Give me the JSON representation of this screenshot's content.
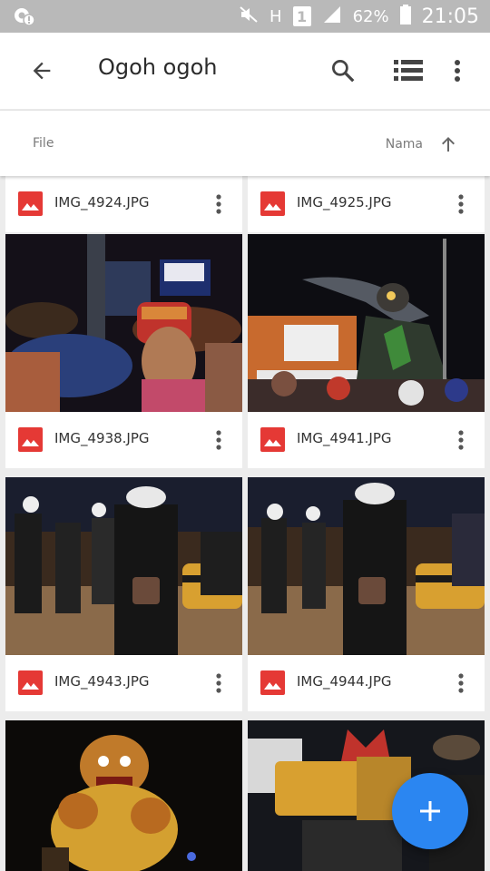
{
  "status_bar": {
    "network_label": "H",
    "sim_label": "1",
    "battery_percent": "62%",
    "time": "21:05",
    "icons": [
      "notification-alert-icon",
      "mute-icon",
      "sim-icon",
      "signal-icon",
      "battery-icon"
    ]
  },
  "app_bar": {
    "title": "Ogoh ogoh",
    "icons": [
      "back-arrow-icon",
      "search-icon",
      "list-view-icon",
      "more-vert-icon"
    ]
  },
  "sort_bar": {
    "left_label": "File",
    "sort_label": "Nama",
    "sort_icon": "arrow-up-icon"
  },
  "files": [
    {
      "name": "IMG_4924.JPG"
    },
    {
      "name": "IMG_4925.JPG"
    },
    {
      "name": "IMG_4938.JPG"
    },
    {
      "name": "IMG_4941.JPG"
    },
    {
      "name": "IMG_4943.JPG"
    },
    {
      "name": "IMG_4944.JPG"
    },
    {
      "name": ""
    },
    {
      "name": ""
    }
  ],
  "fab": {
    "icon": "plus-icon"
  },
  "colors": {
    "status_bar": "#b9b9b9",
    "file_icon": "#e53935",
    "fab": "#2b86f1",
    "text": "#333333",
    "secondary_text": "#7a7a7a"
  }
}
